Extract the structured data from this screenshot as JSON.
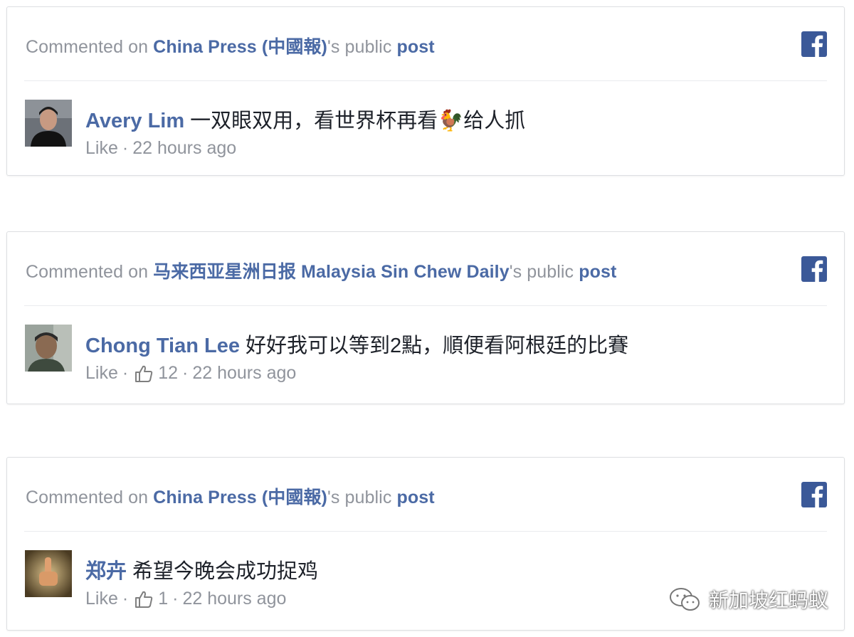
{
  "colors": {
    "link": "#4b6aa5",
    "muted": "#90949c",
    "text": "#1d2129",
    "facebook_blue": "#3b5998",
    "border": "#dddfe2"
  },
  "cards": [
    {
      "header": {
        "prefix": "Commented on ",
        "page_name": "China Press (中國報)",
        "suffix": "'s public ",
        "post_label": "post"
      },
      "icon": "facebook-icon",
      "author": "Avery Lim",
      "comment_before": "一双眼双用，看世界杯再看",
      "comment_emoji": "🐓",
      "comment_after": "给人抓",
      "like_label": "Like",
      "separator": "·",
      "like_count": "",
      "time": "22 hours ago"
    },
    {
      "header": {
        "prefix": "Commented on ",
        "page_name": "马来西亚星洲日报 Malaysia Sin Chew Daily",
        "suffix": "'s public ",
        "post_label": "post"
      },
      "icon": "facebook-icon",
      "author": "Chong Tian Lee",
      "comment_before": "好好我可以等到2點，順便看阿根廷的比賽",
      "comment_emoji": "",
      "comment_after": "",
      "like_label": "Like",
      "separator": "·",
      "like_count": "12",
      "time": "22 hours ago"
    },
    {
      "header": {
        "prefix": "Commented on ",
        "page_name": "China Press (中國報)",
        "suffix": "'s public ",
        "post_label": "post"
      },
      "icon": "facebook-icon",
      "author": "郑卉",
      "comment_before": "希望今晚会成功捉鸡",
      "comment_emoji": "",
      "comment_after": "",
      "like_label": "Like",
      "separator": "·",
      "like_count": "1",
      "time": "22 hours ago"
    }
  ],
  "watermark": {
    "icon": "wechat-icon",
    "text": "新加坡红蚂蚁"
  }
}
